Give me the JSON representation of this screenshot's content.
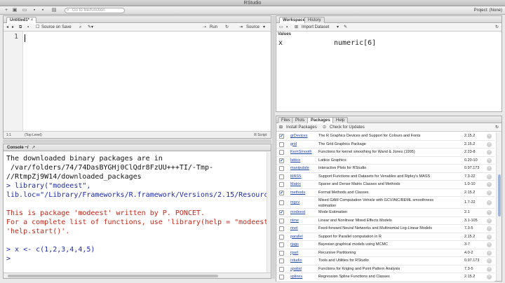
{
  "window": {
    "title": "RStudio"
  },
  "toolbar": {
    "goto_placeholder": "Go to file/function",
    "project_label": "Project: (None)"
  },
  "editor": {
    "tab_label": "Untitled1*",
    "source_on_save": "Source on Save",
    "run_label": "Run",
    "source_label": "Source",
    "line_number": "1",
    "status_position": "1:1",
    "status_scope": "(Top Level)",
    "status_type": "R Script"
  },
  "console": {
    "title": "Console ~/",
    "lines": [
      {
        "text": "The downloaded binary packages are in",
        "color": "black"
      },
      {
        "text": " /var/folders/74/74DasBYGHj0ClQdr8FzUU+++TI/-Tmp-",
        "color": "black"
      },
      {
        "text": "//RtmpZj9W14/downloaded_packages",
        "color": "black"
      },
      {
        "text": "> library(\"modeest\",",
        "color": "blue"
      },
      {
        "text": "lib.loc=\"/Library/Frameworks/R.framework/Versions/2.15/Resource",
        "color": "blue"
      },
      {
        "text": "",
        "color": "black"
      },
      {
        "text": "This is package 'modeest' written by P. PONCET.",
        "color": "red"
      },
      {
        "text": "For a complete list of functions, use 'library(help = \"modeest\"",
        "color": "red"
      },
      {
        "text": "'help.start()'.",
        "color": "red"
      },
      {
        "text": "",
        "color": "black"
      },
      {
        "text": "> x <- c(1,2,3,4,4,5)",
        "color": "blue"
      },
      {
        "text": ">",
        "color": "blue"
      }
    ]
  },
  "workspace": {
    "tabs": [
      "Workspace",
      "History"
    ],
    "import_label": "Import Dataset",
    "section_label": "Values",
    "rows": [
      {
        "name": "x",
        "value": "numeric[6]"
      }
    ]
  },
  "packages": {
    "tabs": [
      "Files",
      "Plots",
      "Packages",
      "Help"
    ],
    "install_label": "Install Packages",
    "check_label": "Check for Updates",
    "rows": [
      {
        "checked": true,
        "name": "grDevices",
        "desc": "The R Graphics Devices and Support for Colours and Fonts",
        "version": "2.15.2"
      },
      {
        "checked": false,
        "name": "grid",
        "desc": "The Grid Graphics Package",
        "version": "2.15.2"
      },
      {
        "checked": false,
        "name": "KernSmooth",
        "desc": "Functions for kernel smoothing for Wand & Jones (1995)",
        "version": "2.23-8"
      },
      {
        "checked": true,
        "name": "lattice",
        "desc": "Lattice Graphics",
        "version": "0.20-10"
      },
      {
        "checked": false,
        "name": "manipulate",
        "desc": "Interactive Plots for RStudio",
        "version": "0.97.173"
      },
      {
        "checked": false,
        "name": "MASS",
        "desc": "Support Functions and Datasets for Venables and Ripley's MASS",
        "version": "7.3-22"
      },
      {
        "checked": false,
        "name": "Matrix",
        "desc": "Sparse and Dense Matrix Classes and Methods",
        "version": "1.0-10"
      },
      {
        "checked": true,
        "name": "methods",
        "desc": "Formal Methods and Classes",
        "version": "2.15.2"
      },
      {
        "checked": false,
        "name": "mgcv",
        "desc": "Mixed GAM Computation Vehicle with GCV/AIC/REML smoothness estimation",
        "version": "1.7-22",
        "tall": true
      },
      {
        "checked": true,
        "name": "modeest",
        "desc": "Mode Estimation",
        "version": "2.1"
      },
      {
        "checked": false,
        "name": "nlme",
        "desc": "Linear and Nonlinear Mixed Effects Models",
        "version": "3.1-105"
      },
      {
        "checked": false,
        "name": "nnet",
        "desc": "Feed-forward Neural Networks and Multinomial Log-Linear Models",
        "version": "7.3-5"
      },
      {
        "checked": false,
        "name": "parallel",
        "desc": "Support for Parallel computation in R",
        "version": "2.15.2"
      },
      {
        "checked": false,
        "name": "rjags",
        "desc": "Bayesian graphical models using MCMC",
        "version": "3-7"
      },
      {
        "checked": false,
        "name": "rpart",
        "desc": "Recursive Partitioning",
        "version": "4.0-2"
      },
      {
        "checked": false,
        "name": "rstudio",
        "desc": "Tools and Utilities for RStudio",
        "version": "0.97.173"
      },
      {
        "checked": false,
        "name": "spatial",
        "desc": "Functions for Kriging and Point Pattern Analysis",
        "version": "7.3-5"
      },
      {
        "checked": false,
        "name": "splines",
        "desc": "Regression Spline Functions and Classes",
        "version": "2.15.2"
      }
    ]
  }
}
